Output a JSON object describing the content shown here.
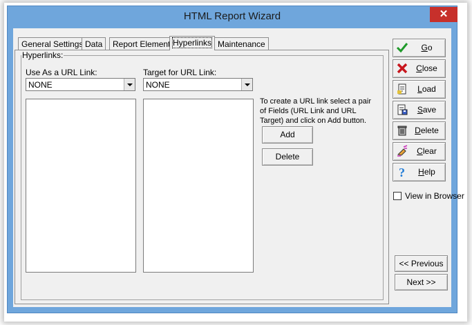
{
  "window": {
    "title": "HTML Report Wizard",
    "close_glyph": "✕"
  },
  "tabs": [
    {
      "label": "General Settings"
    },
    {
      "label": "Data"
    },
    {
      "label": "Report Elements"
    },
    {
      "label": "Hyperlinks"
    },
    {
      "label": "Maintenance"
    }
  ],
  "active_tab": "Hyperlinks",
  "hyperlinks": {
    "group_label": "Hyperlinks:",
    "url_link_label": "Use As a URL Link:",
    "url_link_value": "NONE",
    "target_label": "Target for URL Link:",
    "target_value": "NONE",
    "instructions": "To create a URL link select a pair of Fields (URL Link and URL Target) and click on Add button.",
    "add_label": "Add",
    "delete_label": "Delete"
  },
  "sidebar": {
    "go": "Go",
    "close": "Close",
    "load": "Load",
    "save": "Save",
    "delete": "Delete",
    "clear": "Clear",
    "help": "Help",
    "view_in_browser": "View in Browser",
    "view_in_browser_checked": false,
    "previous": "<< Previous",
    "next": "Next >>"
  },
  "icons": {
    "go": "checkmark-icon",
    "close": "red-x-icon",
    "load": "document-load-icon",
    "save": "document-save-icon",
    "delete": "trash-can-icon",
    "clear": "eraser-icon",
    "help": "question-mark-icon"
  },
  "colors": {
    "title_bar": "#6fa6dc",
    "close_button": "#c7302b",
    "dialog_face": "#f0f0f0"
  }
}
